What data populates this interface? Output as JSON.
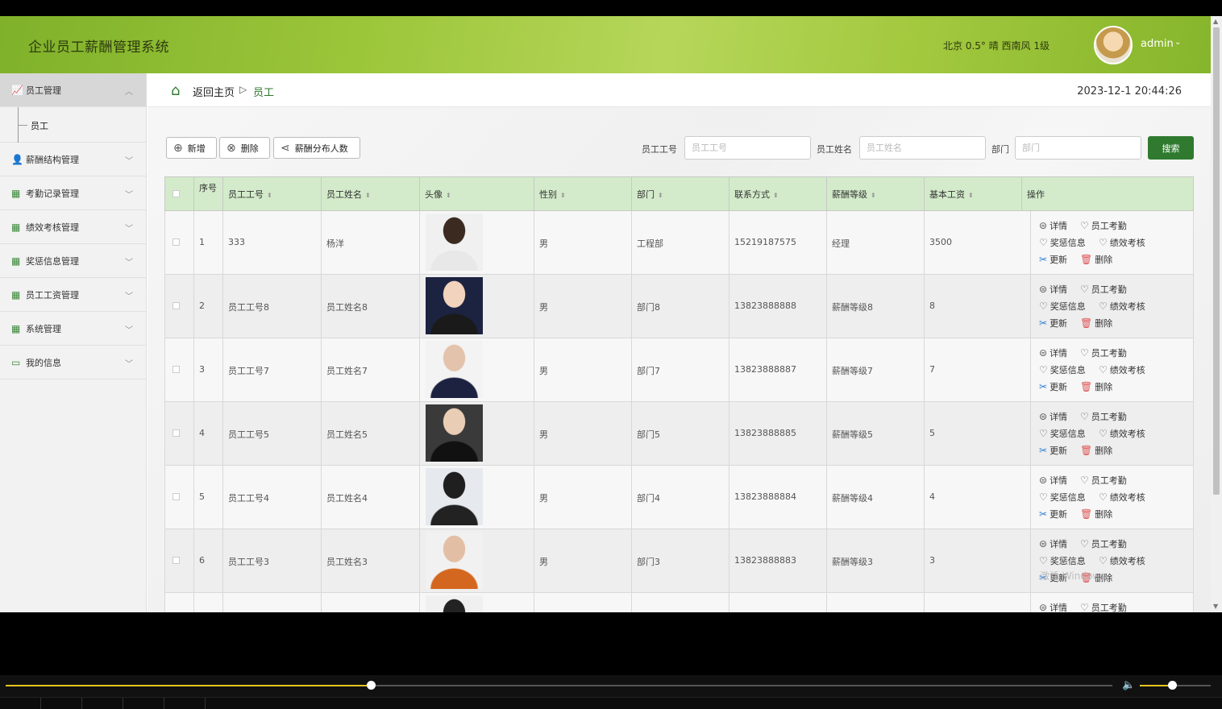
{
  "header": {
    "title": "企业员工薪酬管理系统",
    "weather": "北京  0.5°  晴  西南风  1级",
    "username": "admin",
    "caret": "⌄"
  },
  "sidebar": {
    "items": [
      {
        "label": "员工管理",
        "icon": "chart-icon",
        "active": true,
        "caret": "︿"
      },
      {
        "label": "薪酬结构管理",
        "icon": "user-icon",
        "caret": "﹀"
      },
      {
        "label": "考勤记录管理",
        "icon": "grid-icon",
        "caret": "﹀"
      },
      {
        "label": "绩效考核管理",
        "icon": "grid-icon",
        "caret": "﹀"
      },
      {
        "label": "奖惩信息管理",
        "icon": "grid-icon",
        "caret": "﹀"
      },
      {
        "label": "员工工资管理",
        "icon": "grid-icon",
        "caret": "﹀"
      },
      {
        "label": "系统管理",
        "icon": "grid-icon",
        "caret": "﹀"
      },
      {
        "label": "我的信息",
        "icon": "card-icon",
        "caret": "﹀"
      }
    ],
    "sub_items": [
      {
        "label": "员工"
      }
    ]
  },
  "breadcrumb": {
    "home": "返回主页",
    "separator": "▷",
    "current": "员工"
  },
  "datetime": "2023-12-1 20:44:26",
  "toolbar": {
    "add": "新增",
    "delete": "删除",
    "salary_dist": "薪酬分布人数"
  },
  "filters": {
    "emp_no_label": "员工工号",
    "emp_no_placeholder": "员工工号",
    "emp_name_label": "员工姓名",
    "emp_name_placeholder": "员工姓名",
    "dept_label": "部门",
    "dept_placeholder": "部门",
    "search": "搜索"
  },
  "table": {
    "headers": [
      "序号",
      "员工工号",
      "员工姓名",
      "头像",
      "性别",
      "部门",
      "联系方式",
      "薪酬等级",
      "基本工资",
      "操作"
    ],
    "rows": [
      {
        "idx": "1",
        "no": "333",
        "name": "杨洋",
        "gender": "男",
        "dept": "工程部",
        "phone": "15219187575",
        "level": "经理",
        "salary": "3500"
      },
      {
        "idx": "2",
        "no": "员工工号8",
        "name": "员工姓名8",
        "gender": "男",
        "dept": "部门8",
        "phone": "13823888888",
        "level": "薪酬等级8",
        "salary": "8"
      },
      {
        "idx": "3",
        "no": "员工工号7",
        "name": "员工姓名7",
        "gender": "男",
        "dept": "部门7",
        "phone": "13823888887",
        "level": "薪酬等级7",
        "salary": "7"
      },
      {
        "idx": "4",
        "no": "员工工号5",
        "name": "员工姓名5",
        "gender": "男",
        "dept": "部门5",
        "phone": "13823888885",
        "level": "薪酬等级5",
        "salary": "5"
      },
      {
        "idx": "5",
        "no": "员工工号4",
        "name": "员工姓名4",
        "gender": "男",
        "dept": "部门4",
        "phone": "13823888884",
        "level": "薪酬等级4",
        "salary": "4"
      },
      {
        "idx": "6",
        "no": "员工工号3",
        "name": "员工姓名3",
        "gender": "男",
        "dept": "部门3",
        "phone": "13823888883",
        "level": "薪酬等级3",
        "salary": "3"
      },
      {
        "idx": "",
        "no": "",
        "name": "",
        "gender": "",
        "dept": "",
        "phone": "",
        "level": "",
        "salary": ""
      }
    ],
    "ops": {
      "detail": "详情",
      "attendance": "员工考勤",
      "reward": "奖惩信息",
      "perf": "绩效考核",
      "update": "更新",
      "remove": "删除"
    }
  },
  "watermark": "激活 Windows",
  "player": {
    "progress": 0.33,
    "volume": 0.45
  },
  "colors": {
    "accent": "#2f7a2f",
    "header_green": "#9cc63a",
    "table_head": "#d3ebca",
    "progress": "#e7c31f"
  }
}
